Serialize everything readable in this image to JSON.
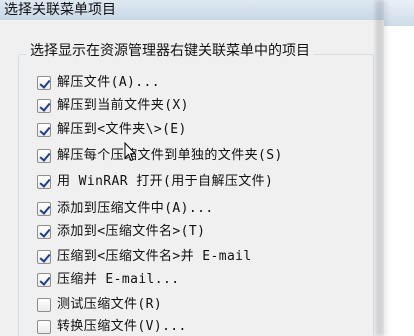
{
  "dialog": {
    "title": "选择关联菜单项目",
    "group_title": "选择显示在资源管理器右键关联菜单中的项目"
  },
  "items": [
    {
      "label": "解压文件(A)...",
      "checked": true
    },
    {
      "label": "解压到当前文件夹(X)",
      "checked": true
    },
    {
      "label": "解压到<文件夹\\>(E)",
      "checked": true
    },
    {
      "label": "解压每个压缩文件到单独的文件夹(S)",
      "checked": true
    },
    {
      "label": "用 WinRAR 打开(用于自解压文件)",
      "checked": true
    },
    {
      "label": "添加到压缩文件中(A)...",
      "checked": true
    },
    {
      "label": "添加到<压缩文件名>(T)",
      "checked": true
    },
    {
      "label": "压缩到<压缩文件名>并 E-mail",
      "checked": true
    },
    {
      "label": "压缩并 E-mail...",
      "checked": true
    },
    {
      "label": "测试压缩文件(R)",
      "checked": false
    },
    {
      "label": "转换压缩文件(V)...",
      "checked": false
    }
  ]
}
